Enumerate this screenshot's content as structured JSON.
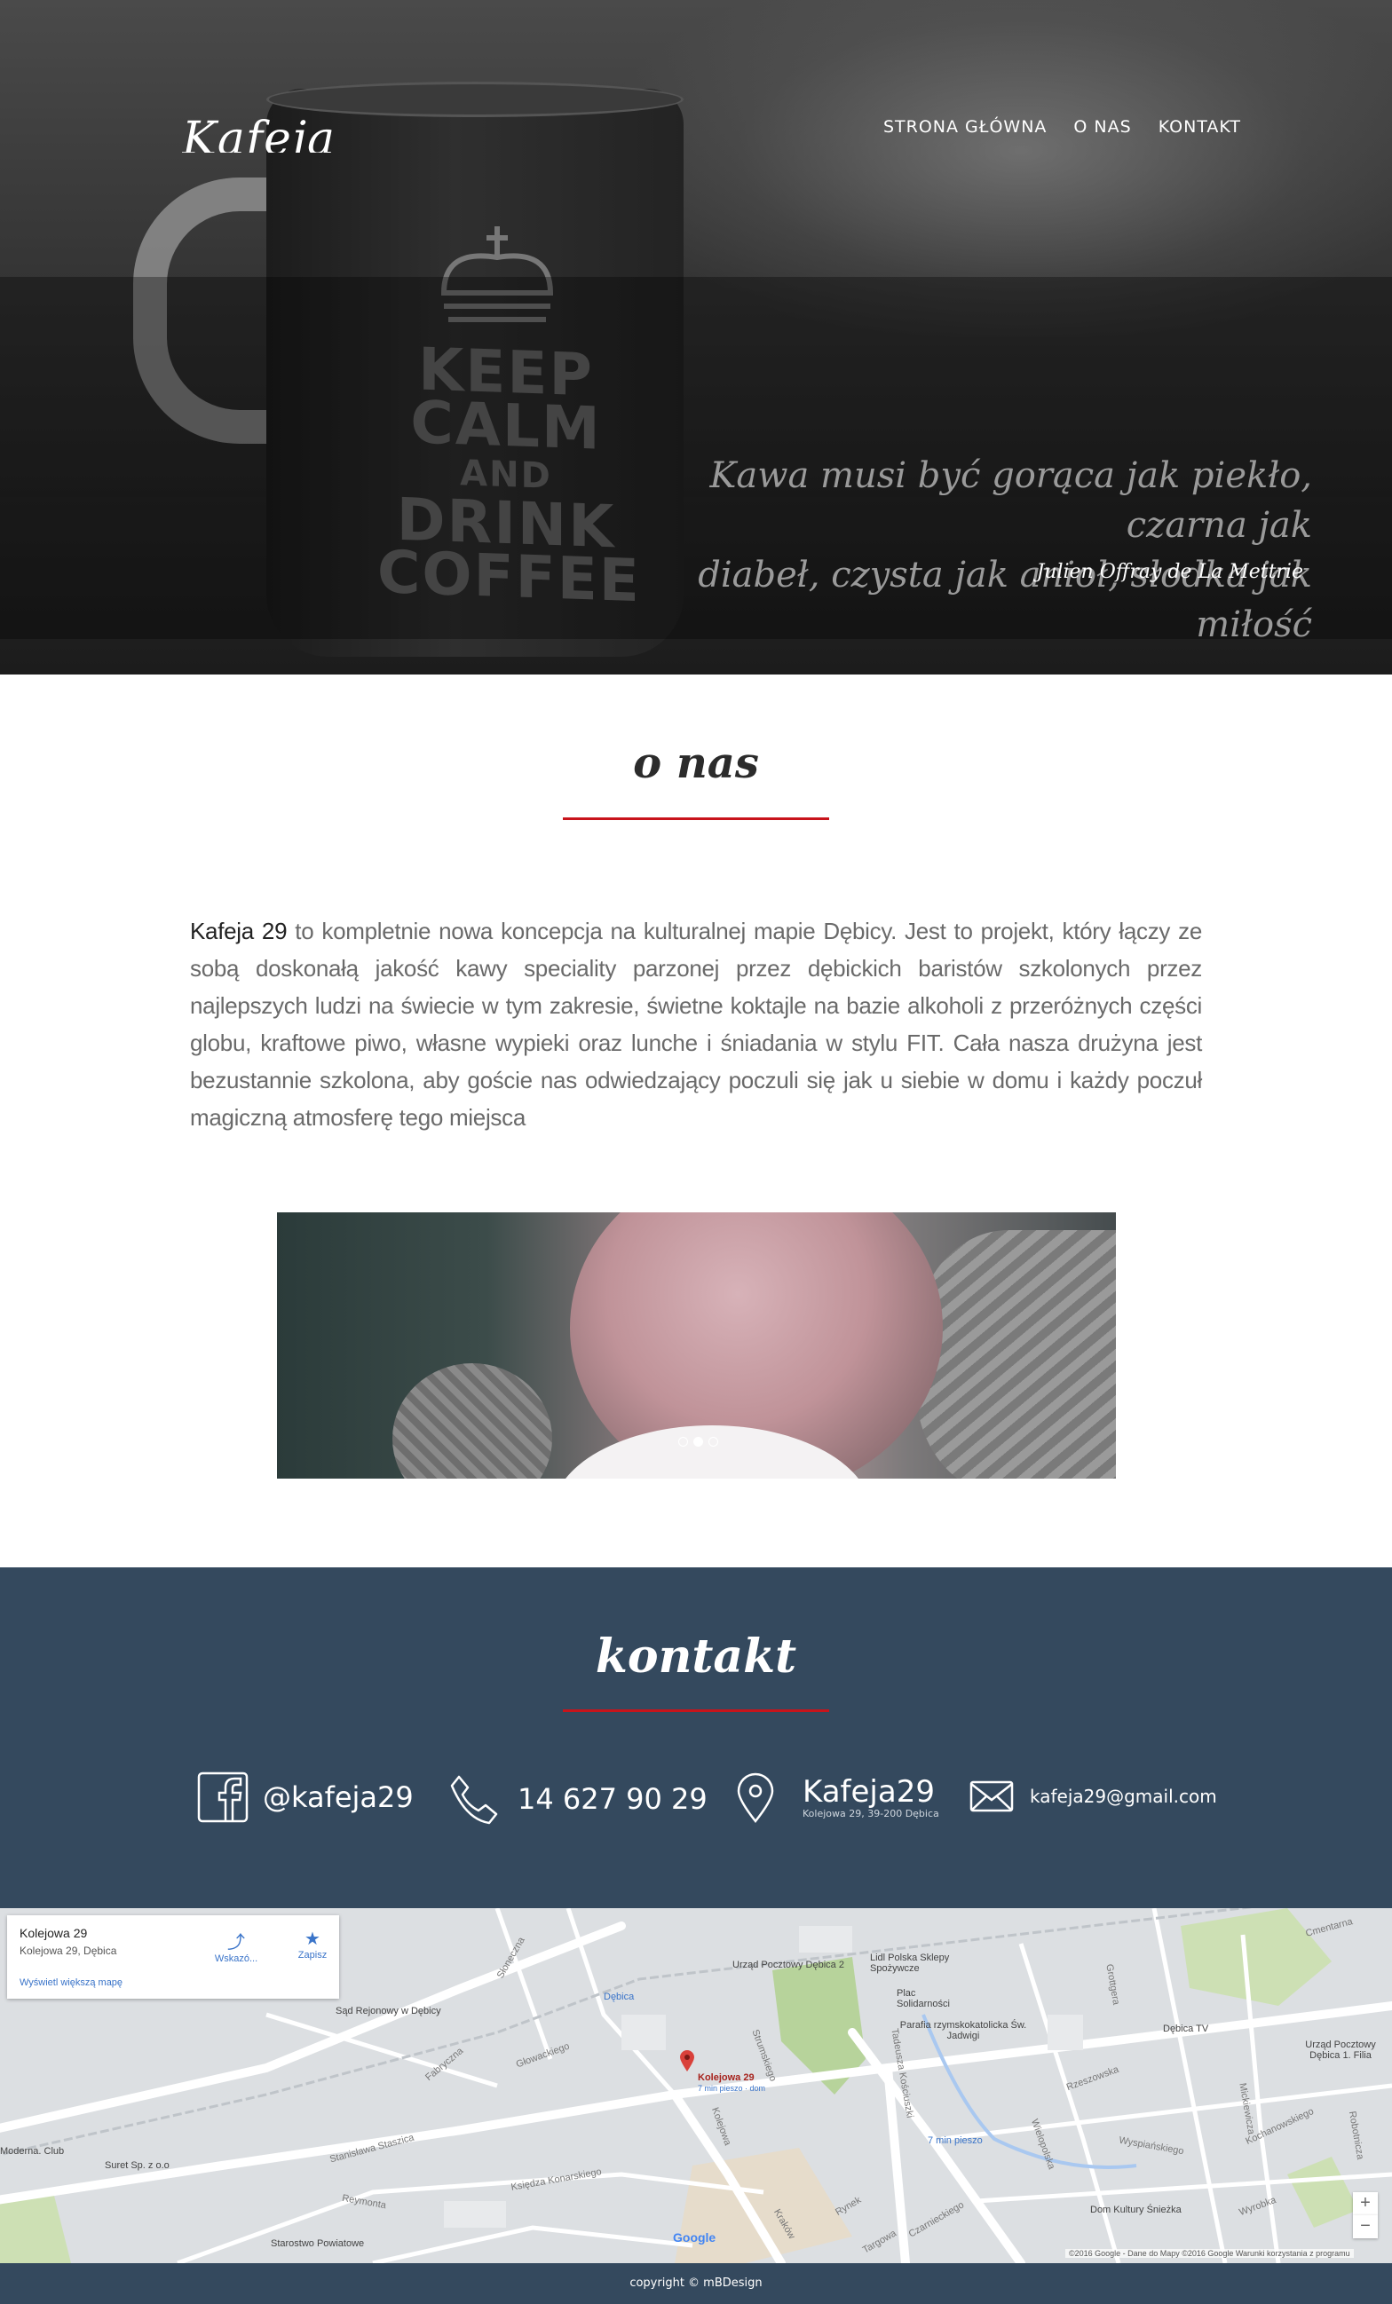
{
  "header": {
    "logo": "Kafeja",
    "nav": [
      "STRONA GŁÓWNA",
      "O NAS",
      "KONTAKT"
    ]
  },
  "hero": {
    "mug_lines": [
      "KEEP",
      "CALM",
      "AND",
      "DRINK",
      "COFFEE"
    ],
    "quote_line1": "Kawa musi być gorąca jak piekło, czarna jak",
    "quote_line2": "diabeł, czysta jak anioł, słodka jak miłość",
    "quote_author": "Julien Offray de La Mettrie"
  },
  "about": {
    "title": "o nas",
    "brand": "Kafeja 29",
    "text": " to kompletnie nowa koncepcja na kulturalnej mapie Dębicy. Jest to projekt, który łączy ze sobą doskonałą jakość kawy speciality parzonej przez dębickich baristów szkolonych przez najlepszych ludzi na świecie w tym zakresie, świetne koktajle na bazie alkoholi z przeróżnych części globu, kraftowe piwo, własne wypieki oraz lunche i śniadania w stylu FIT. Cała nasza drużyna jest bezustannie szkolona, aby goście nas odwiedzający poczuli się jak u siebie w domu i każdy poczuł magiczną atmosferę tego miejsca"
  },
  "slider": {
    "slide_count": 3,
    "active_index": 1
  },
  "contact": {
    "title": "kontakt",
    "facebook": "@kafeja29",
    "phone": "14 627 90 29",
    "location_name": "Kafeja29",
    "location_address": "Kolejowa 29, 39-200 Dębica",
    "email": "kafeja29@gmail.com"
  },
  "map": {
    "card_title": "Kolejowa 29",
    "card_subtitle": "Kolejowa 29, Dębica",
    "directions": "Wskazó...",
    "save": "Zapisz",
    "more_link": "Wyświetl większą mapę",
    "pin_label": "Kolejowa 29",
    "pin_sub": "7 min pieszo · dom",
    "labels": [
      "Urząd Pocztowy Dębica 2",
      "Lidl Polska Sklepy Spożywcze",
      "Plac Solidarności",
      "Parafia rzymskokatolicka Św. Jadwigi",
      "Sąd Rejonowy w Dębicy",
      "Dębica",
      "Dębica TV",
      "Urząd Pocztowy Dębica 1. Filia",
      "Moderna. Club",
      "Suret Sp. z o.o",
      "Dom Kultury Śnieżka",
      "Starostwo Powiatowe",
      "7 min pieszo"
    ],
    "roads": [
      "Słoneczna",
      "Głowackiego",
      "Fabryczna",
      "Stanisława Staszica",
      "Księdza Konarskiego",
      "Reymonta",
      "Kolejowa",
      "Rynek",
      "Kraków",
      "Targowa",
      "Czarnieckiego",
      "Rzeszowska",
      "Wyspiańskiego",
      "Kochanowskiego",
      "Robotnicza",
      "Cmentarna",
      "Grottgera",
      "Strumskiego",
      "Tadeusza Kościuszki",
      "Wielopolska",
      "Mickiewicza",
      "Wyrobka"
    ],
    "attribution": "©2016 Google - Dane do Mapy ©2016 Google   Warunki korzystania z programu",
    "google": "Google",
    "zoom_in": "+",
    "zoom_out": "−"
  },
  "footer": {
    "copyright": "copyright © mBDesign"
  },
  "colors": {
    "accent": "#c8141b",
    "contact_bg": "#34495e"
  }
}
